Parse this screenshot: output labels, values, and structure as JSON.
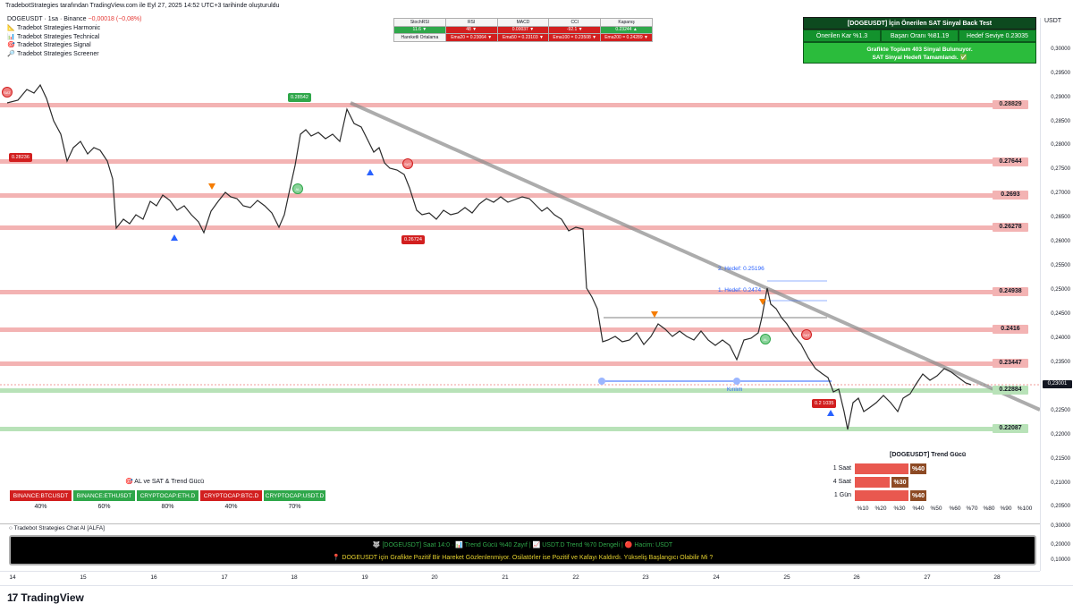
{
  "header": {
    "credit": "TradebotStrategies tarafından TradingView.com ile Eyl 27, 2025 14:52 UTC+3 tarihinde oluşturuldu",
    "symbol": "DOGEUSDT · 1sa · Binance",
    "change": "−0,00018 (−0,08%)"
  },
  "indicators": [
    {
      "icon": "ruler-icon",
      "label": "Tradebot Strategies Harmonic"
    },
    {
      "icon": "chart-icon",
      "label": "Tradebot Strategies Technical"
    },
    {
      "icon": "target-icon",
      "label": "Tradebot Strategies Signal"
    },
    {
      "icon": "magnifier-icon",
      "label": "Tradebot Strategies Screener"
    }
  ],
  "price_axis": {
    "currency": "USDT",
    "ticks": [
      "0,30000",
      "0,29500",
      "0,29000",
      "0,28500",
      "0,28000",
      "0,27500",
      "0,27000",
      "0,26500",
      "0,26000",
      "0,25500",
      "0,25000",
      "0,24500",
      "0,24000",
      "0,23500",
      "0,23000",
      "0,22500",
      "0,22000",
      "0,21500",
      "0,21000",
      "0,20500"
    ],
    "last_price": "0,23001"
  },
  "sub_axis": {
    "ticks": [
      "0,30000",
      "0,20000",
      "0,10000"
    ]
  },
  "time_axis": {
    "ticks": [
      "14",
      "15",
      "16",
      "17",
      "18",
      "19",
      "20",
      "21",
      "22",
      "23",
      "24",
      "25",
      "26",
      "27",
      "28"
    ]
  },
  "levels": [
    {
      "value": "0.28829",
      "color": "#f1a9a9"
    },
    {
      "value": "0.27644",
      "color": "#f1a9a9"
    },
    {
      "value": "0.2693",
      "color": "#f1a9a9"
    },
    {
      "value": "0.26278",
      "color": "#f1a9a9"
    },
    {
      "value": "0.24938",
      "color": "#f1a9a9"
    },
    {
      "value": "0.2416",
      "color": "#f1a9a9"
    },
    {
      "value": "0.23447",
      "color": "#f1a9a9"
    },
    {
      "value": "0.22884",
      "color": "#a8d9a8"
    },
    {
      "value": "0.22087",
      "color": "#a8d9a8"
    }
  ],
  "indicator_table": {
    "headers": [
      "StochRSI",
      "RSI",
      "MACD",
      "CCI",
      "Kapanış"
    ],
    "values": [
      {
        "text": "11.6 ▼",
        "tone": "green"
      },
      {
        "text": "48 ▼",
        "tone": "red"
      },
      {
        "text": "0.00037 ▼",
        "tone": "red"
      },
      {
        "text": "-92.1 ▼",
        "tone": "red"
      },
      {
        "text": "0.23244 ▲",
        "tone": "green"
      }
    ],
    "ma_label": "Hareketli Ortalama",
    "ma_values": [
      "Ema20 = 0.23064 ▼",
      "Ema50 = 0.23103 ▼",
      "Ema100 = 0.23508 ▼",
      "Ema200 = 0.24289 ▼"
    ]
  },
  "backtest": {
    "title": "[DOGEUSDT] İçin Önerilen SAT Sinyal Back Test",
    "kar": "Önerilen Kar %1.3",
    "basari": "Başarı Oranı %81.19",
    "hedef": "Hedef Seviye 0.23035",
    "msg1": "Grafikte Toplam 403 Sinyal Bulunuyor.",
    "msg2": "SAT Sinyal Hedefi Tamamlandı. ✅"
  },
  "signals": {
    "badges": [
      "0.28542",
      "0.28236",
      "0.26724",
      "0.2 1035"
    ],
    "circle_labels": [
      "SAT",
      "AL"
    ]
  },
  "targets": {
    "t2": "2. Hedef: 0.25196",
    "t1": "1. Hedef: 0.2474",
    "kirilim": "Kırılım"
  },
  "trend_panel": {
    "title": "[DOGEUSDT] Trend Gücü",
    "rows": [
      {
        "label": "1 Saat",
        "value": "%40",
        "level": 0.4
      },
      {
        "label": "4 Saat",
        "value": "%30",
        "level": 0.3
      },
      {
        "label": "1 Gün",
        "value": "%40",
        "level": 0.4
      }
    ],
    "columns": [
      "%10",
      "%20",
      "%30",
      "%40",
      "%50",
      "%60",
      "%70",
      "%80",
      "%90",
      "%100"
    ]
  },
  "strength": {
    "title": "AL ve SAT & Trend Gücü",
    "items": [
      {
        "label": "BINANCE:BTCUSDT",
        "pct": "40%",
        "tone": "red"
      },
      {
        "label": "BINANCE:ETHUSDT",
        "pct": "60%",
        "tone": "green"
      },
      {
        "label": "CRYPTOCAP:ETH.D",
        "pct": "80%",
        "tone": "green"
      },
      {
        "label": "CRYPTOCAP:BTC.D",
        "pct": "40%",
        "tone": "red"
      },
      {
        "label": "CRYPTOCAP:USDT.D",
        "pct": "70%",
        "tone": "green"
      }
    ]
  },
  "ai": {
    "label": "Tradebot Strategies Chat AI [ALFA]",
    "line1": "🐺 [DOGEUSDT] Saat 14:0 · 📊 Trend Gücü %40 Zayıf | 📈 USDT.D Trend %70 Dengeli | 🔴 Hacim: USDT",
    "line2": "📍 DOGEUSDT için Grafikte Pozitif Bir Hareket Gözlenlenmiyor. Osilatörler ise Pozitif ve Kafayı Kaldırdı. Yükseliş Başlangıcı Olabilir Mi ?"
  },
  "footer": {
    "brand": "TradingView"
  }
}
